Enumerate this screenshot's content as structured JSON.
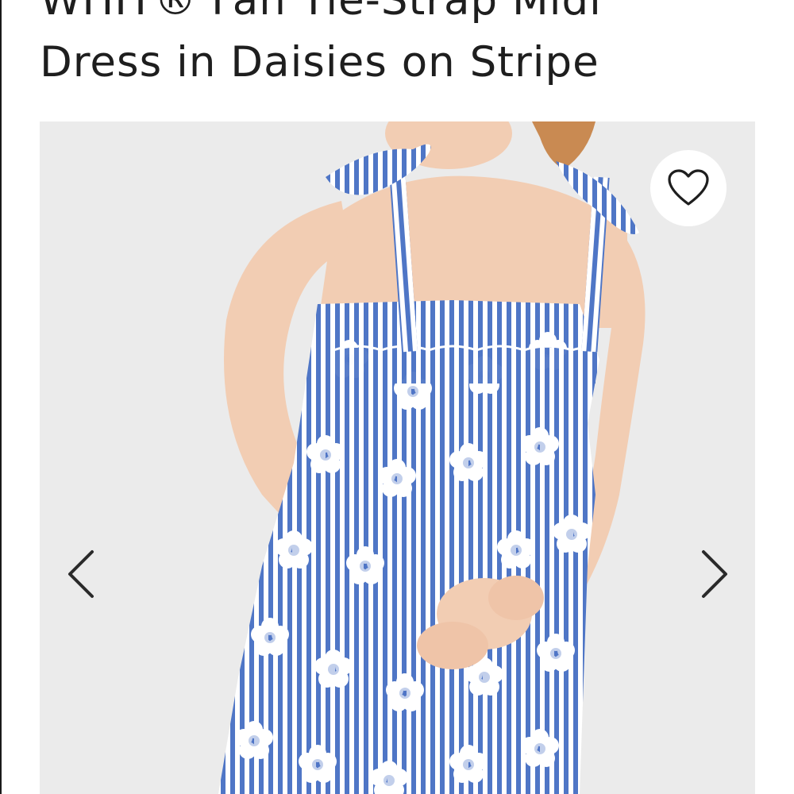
{
  "product": {
    "title_line1": "WHIT® Fan Tie-Strap Midi",
    "title_line2": "Dress in Daisies on Stripe"
  },
  "gallery": {
    "background_color": "#ebebeb",
    "dress_stripe_color": "#4f76c6",
    "dress_base_color": "#ffffff",
    "skin_color": "#f2cdb3",
    "hair_color": "#c98a52"
  },
  "icons": {
    "favorite": "heart-icon",
    "previous": "chevron-left-icon",
    "next": "chevron-right-icon"
  }
}
